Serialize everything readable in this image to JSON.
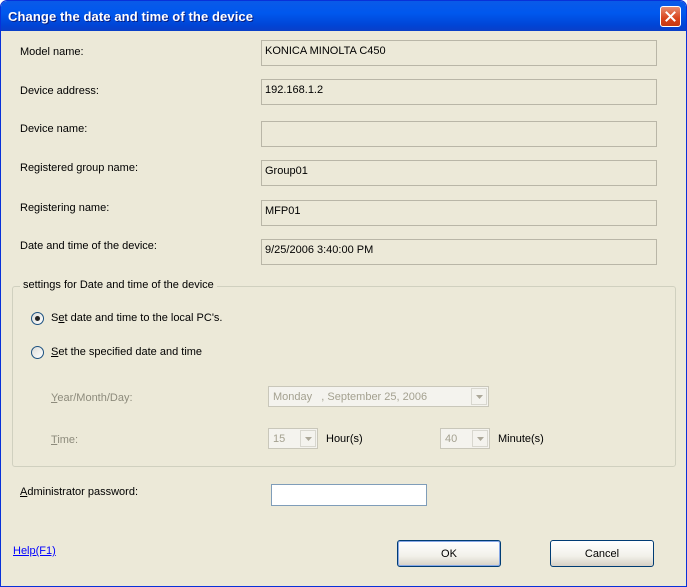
{
  "window": {
    "title": "Change the date and time of the device",
    "close_icon": "close-icon"
  },
  "info_rows": [
    {
      "label": "Model name:",
      "value": "KONICA MINOLTA C450"
    },
    {
      "label": "Device address:",
      "value": "192.168.1.2"
    },
    {
      "label": "Device name:",
      "value": ""
    },
    {
      "label": "Registered group name:",
      "value": "Group01"
    },
    {
      "label": "Registering name:",
      "value": "MFP01"
    },
    {
      "label": "Date and time of the device:",
      "value": "9/25/2006 3:40:00 PM"
    }
  ],
  "settings_group": {
    "legend": "settings for Date and time of the device",
    "option_local": {
      "prefix": "S",
      "accel": "e",
      "rest": "t date and time to the local PC's.",
      "selected": true
    },
    "option_specified": {
      "accel": "S",
      "rest": "et the specified date and time",
      "selected": false
    },
    "date": {
      "accel": "Y",
      "label_rest": "ear/Month/Day:",
      "value": "Monday   , September 25, 2006"
    },
    "time": {
      "accel": "T",
      "label_rest": "ime:",
      "hour": "15",
      "hour_unit": "Hour(s)",
      "minute": "40",
      "minute_unit": "Minute(s)"
    }
  },
  "password": {
    "accel": "A",
    "label_rest": "dministrator password:",
    "value": ""
  },
  "help": {
    "label": "Help(F1)"
  },
  "buttons": {
    "ok": "OK",
    "cancel": "Cancel"
  },
  "colors": {
    "title_bar": "#0058ee",
    "dialog_bg": "#ece9d8",
    "close_button": "#d9441c",
    "link": "#0000ff"
  }
}
